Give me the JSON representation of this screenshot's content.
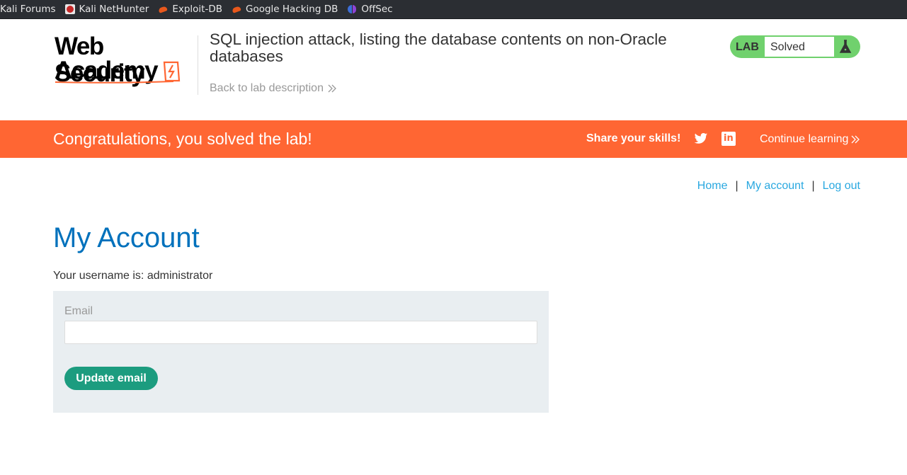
{
  "bookmarks": [
    {
      "label": "Kali Forums",
      "icon": "none"
    },
    {
      "label": "Kali NetHunter",
      "icon": "kali-nethunter-icon"
    },
    {
      "label": "Exploit-DB",
      "icon": "exploit-db-icon"
    },
    {
      "label": "Google Hacking DB",
      "icon": "exploit-db-icon"
    },
    {
      "label": "OffSec",
      "icon": "offsec-icon"
    }
  ],
  "header": {
    "logo_line1": "Web Security",
    "logo_line2": "Academy",
    "lab_title": "SQL injection attack, listing the database contents on non-Oracle databases",
    "back_link": "Back to lab description",
    "lab_tag": "LAB",
    "lab_status": "Solved"
  },
  "banner": {
    "message": "Congratulations, you solved the lab!",
    "share_label": "Share your skills!",
    "continue_label": "Continue learning"
  },
  "nav": {
    "home": "Home",
    "sep": "|",
    "my_account": "My account",
    "log_out": "Log out"
  },
  "main": {
    "title": "My Account",
    "username_line": "Your username is: administrator",
    "email_label": "Email",
    "email_value": "",
    "update_button": "Update email"
  },
  "colors": {
    "accent_orange": "#ff6633",
    "lab_green": "#70d16d",
    "title_blue": "#0071bc",
    "link_blue": "#29a8e0",
    "button_green": "#1c9c7f",
    "panel_gray": "#e9eef1"
  }
}
